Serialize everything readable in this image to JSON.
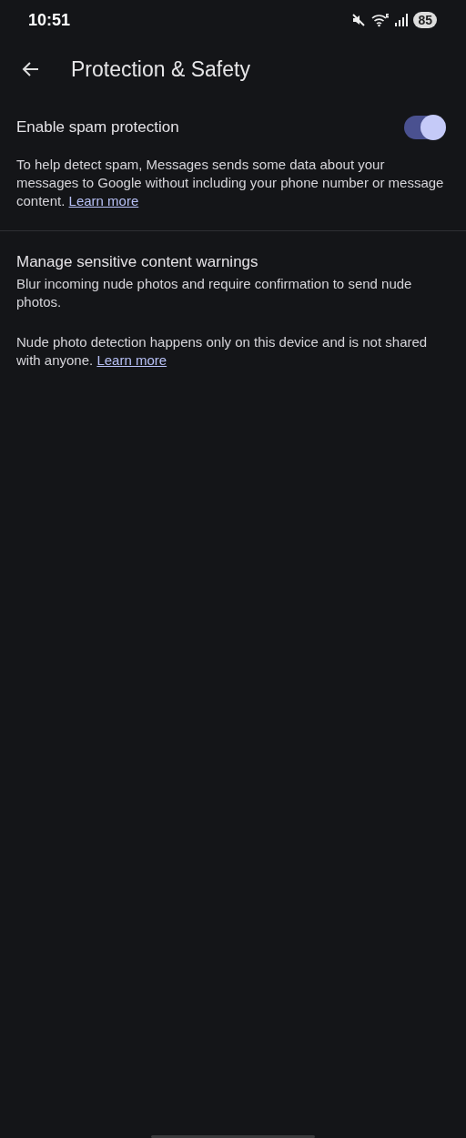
{
  "status_bar": {
    "time": "10:51",
    "battery": "85"
  },
  "app_bar": {
    "title": "Protection & Safety"
  },
  "spam": {
    "title": "Enable spam protection",
    "on": true,
    "description": "To help detect spam, Messages sends some data about your messages to Google without including your phone number or message content.",
    "link": "Learn more"
  },
  "sensitive": {
    "title": "Manage sensitive content warnings",
    "summary": "Blur incoming nude photos and require confirmation to send nude photos.",
    "note": "Nude photo detection happens only on this device and is not shared with anyone.",
    "link": "Learn more"
  }
}
